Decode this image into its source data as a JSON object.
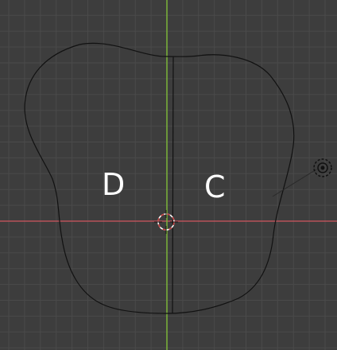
{
  "viewport": {
    "background_color": "#3d3d3d",
    "grid_color": "#4a4a4a",
    "x_axis_color": "#b8525a",
    "y_axis_color": "#7bb33a",
    "outline_color": "#111111",
    "cursor_color": "#ffffff",
    "cursor_accent_color": "#c23b3b"
  },
  "regions": [
    {
      "label": "D"
    },
    {
      "label": "C"
    }
  ],
  "icons": {
    "cursor": "3d-cursor-icon",
    "light": "light-object-icon"
  }
}
